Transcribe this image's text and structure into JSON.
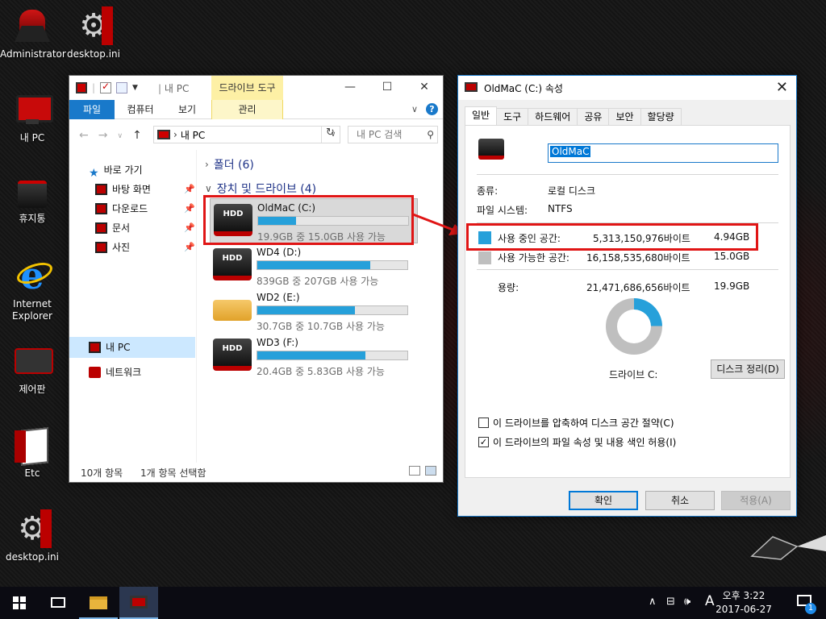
{
  "desktop": {
    "icons": [
      {
        "label": "Administrator"
      },
      {
        "label": "desktop.ini"
      },
      {
        "label": "내 PC"
      },
      {
        "label": "휴지통"
      },
      {
        "label": "Internet Explorer"
      },
      {
        "label": "제어판"
      },
      {
        "label": "Etc"
      },
      {
        "label": "desktop.ini"
      }
    ]
  },
  "explorer": {
    "title": "내 PC",
    "title_sep": "|",
    "contextual_tab": "드라이브 도구",
    "ribbon_tabs": {
      "file": "파일",
      "computer": "컴퓨터",
      "view": "보기",
      "manage": "관리"
    },
    "help": "?",
    "address": {
      "chevron": "›",
      "location": "내 PC"
    },
    "search_placeholder": "내 PC 검색",
    "nav": {
      "quick_access": "바로 가기",
      "desktop": "바탕 화면",
      "downloads": "다운로드",
      "documents": "문서",
      "pictures": "사진",
      "this_pc": "내 PC",
      "network": "네트워크"
    },
    "groups": {
      "folders": "폴더 (6)",
      "devices": "장치 및 드라이브 (4)"
    },
    "drives": [
      {
        "name": "OldMaC (C:)",
        "info": "19.9GB 중 15.0GB 사용 가능",
        "used_fraction": 0.25,
        "icon_text": "HDD"
      },
      {
        "name": "WD4 (D:)",
        "info": "839GB 중 207GB 사용 가능",
        "used_fraction": 0.75,
        "icon_text": "HDD"
      },
      {
        "name": "WD2 (E:)",
        "info": "30.7GB 중 10.7GB 사용 가능",
        "used_fraction": 0.65,
        "icon_text": ""
      },
      {
        "name": "WD3 (F:)",
        "info": "20.4GB 중 5.83GB 사용 가능",
        "used_fraction": 0.72,
        "icon_text": "HDD"
      }
    ],
    "status": {
      "items": "10개 항목",
      "selected": "1개 항목 선택함"
    }
  },
  "properties": {
    "title": "OldMaC (C:) 속성",
    "tabs": [
      "일반",
      "도구",
      "하드웨어",
      "공유",
      "보안",
      "할당량"
    ],
    "name_value": "OldMaC",
    "type_label": "종류:",
    "type_value": "로컬 디스크",
    "fs_label": "파일 시스템:",
    "fs_value": "NTFS",
    "used_label": "사용 중인 공간:",
    "used_bytes": "5,313,150,976바이트",
    "used_size": "4.94GB",
    "free_label": "사용 가능한 공간:",
    "free_bytes": "16,158,535,680바이트",
    "free_size": "15.0GB",
    "capacity_label": "용량:",
    "capacity_bytes": "21,471,686,656바이트",
    "capacity_size": "19.9GB",
    "used_fraction": 0.247,
    "drive_label": "드라이브 C:",
    "cleanup_button": "디스크 정리(D)",
    "compress_label": "이 드라이브를 압축하여 디스크 공간 절약(C)",
    "index_label": "이 드라이브의 파일 속성 및 내용 색인 허용(I)",
    "ok": "확인",
    "cancel": "취소",
    "apply": "적용(A)",
    "colors": {
      "used": "#26a0da",
      "free": "#bfbfbf"
    }
  },
  "taskbar": {
    "time": "오후 3:22",
    "date": "2017-06-27",
    "ime": "A",
    "notifications": "1"
  }
}
